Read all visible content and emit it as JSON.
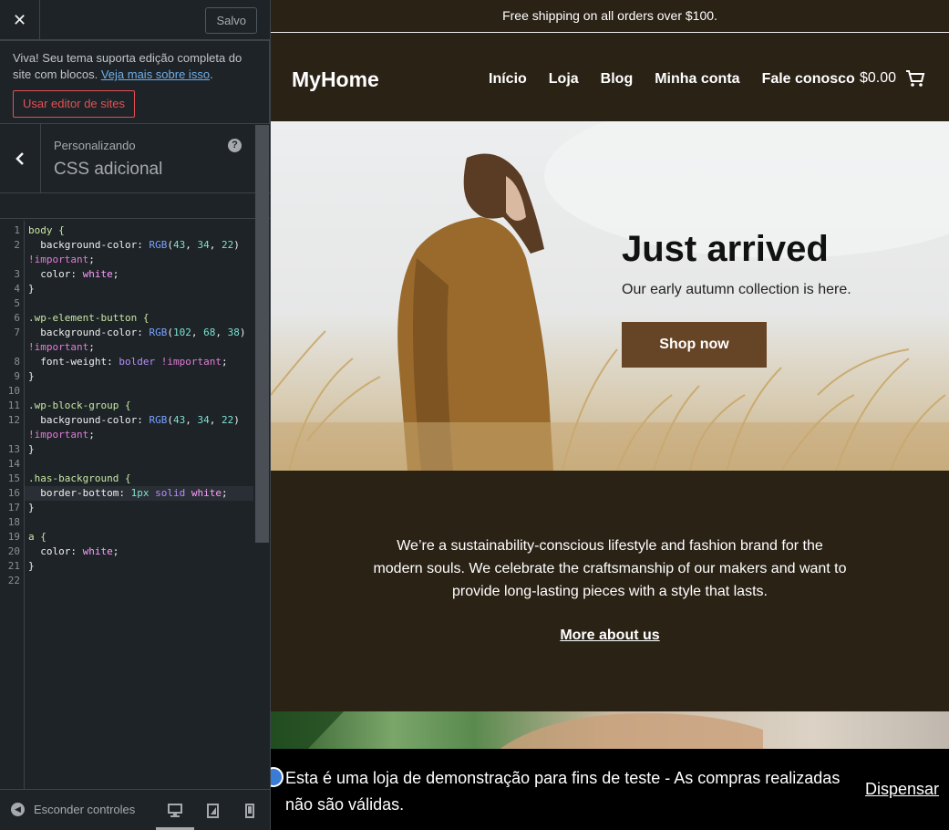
{
  "panel": {
    "saved_label": "Salvo",
    "notice": {
      "text": "Viva! Seu tema suporta edição completa do site com blocos. ",
      "link": "Veja mais sobre isso",
      "after_link": ".",
      "button": "Usar editor de sites"
    },
    "customizing_label": "Personalizando",
    "section_title": "CSS adicional",
    "footer": {
      "hide_controls": "Esconder controles"
    },
    "line_numbers": [
      "1",
      "2",
      "",
      "3",
      "4",
      "5",
      "6",
      "7",
      "",
      "8",
      "9",
      "10",
      "11",
      "12",
      "",
      "13",
      "14",
      "15",
      "16",
      "17",
      "18",
      "19",
      "20",
      "21",
      "22"
    ],
    "code_lines": [
      [
        {
          "t": "body {",
          "c": "t-sel"
        }
      ],
      [
        {
          "t": "  background-color: ",
          "c": "t-prop"
        },
        {
          "t": "RGB",
          "c": "t-fn"
        },
        {
          "t": "(",
          "c": "t-prop"
        },
        {
          "t": "43",
          "c": "t-num"
        },
        {
          "t": ", ",
          "c": "t-prop"
        },
        {
          "t": "34",
          "c": "t-num"
        },
        {
          "t": ", ",
          "c": "t-prop"
        },
        {
          "t": "22",
          "c": "t-num"
        },
        {
          "t": ")",
          "c": "t-prop"
        }
      ],
      [
        {
          "t": "!important",
          "c": "t-imp"
        },
        {
          "t": ";",
          "c": "t-prop"
        }
      ],
      [
        {
          "t": "  color: ",
          "c": "t-prop"
        },
        {
          "t": "white",
          "c": "t-str"
        },
        {
          "t": ";",
          "c": "t-prop"
        }
      ],
      [
        {
          "t": "}",
          "c": "t-prop"
        }
      ],
      [
        {
          "t": "",
          "c": "t-prop"
        }
      ],
      [
        {
          "t": ".wp-element-button {",
          "c": "t-sel"
        }
      ],
      [
        {
          "t": "  background-color: ",
          "c": "t-prop"
        },
        {
          "t": "RGB",
          "c": "t-fn"
        },
        {
          "t": "(",
          "c": "t-prop"
        },
        {
          "t": "102",
          "c": "t-num"
        },
        {
          "t": ", ",
          "c": "t-prop"
        },
        {
          "t": "68",
          "c": "t-num"
        },
        {
          "t": ", ",
          "c": "t-prop"
        },
        {
          "t": "38",
          "c": "t-num"
        },
        {
          "t": ")",
          "c": "t-prop"
        }
      ],
      [
        {
          "t": "!important",
          "c": "t-imp"
        },
        {
          "t": ";",
          "c": "t-prop"
        }
      ],
      [
        {
          "t": "  font-weight: ",
          "c": "t-prop"
        },
        {
          "t": "bolder",
          "c": "t-kw"
        },
        {
          "t": " ",
          "c": "t-prop"
        },
        {
          "t": "!important",
          "c": "t-imp"
        },
        {
          "t": ";",
          "c": "t-prop"
        }
      ],
      [
        {
          "t": "}",
          "c": "t-prop"
        }
      ],
      [
        {
          "t": "",
          "c": "t-prop"
        }
      ],
      [
        {
          "t": ".wp-block-group {",
          "c": "t-sel"
        }
      ],
      [
        {
          "t": "  background-color: ",
          "c": "t-prop"
        },
        {
          "t": "RGB",
          "c": "t-fn"
        },
        {
          "t": "(",
          "c": "t-prop"
        },
        {
          "t": "43",
          "c": "t-num"
        },
        {
          "t": ", ",
          "c": "t-prop"
        },
        {
          "t": "34",
          "c": "t-num"
        },
        {
          "t": ", ",
          "c": "t-prop"
        },
        {
          "t": "22",
          "c": "t-num"
        },
        {
          "t": ")",
          "c": "t-prop"
        }
      ],
      [
        {
          "t": "!important",
          "c": "t-imp"
        },
        {
          "t": ";",
          "c": "t-prop"
        }
      ],
      [
        {
          "t": "}",
          "c": "t-prop"
        }
      ],
      [
        {
          "t": "",
          "c": "t-prop"
        }
      ],
      [
        {
          "t": ".has-background {",
          "c": "t-sel"
        }
      ],
      [
        {
          "t": "  border-bottom: ",
          "c": "t-prop"
        },
        {
          "t": "1px",
          "c": "t-num"
        },
        {
          "t": " ",
          "c": "t-prop"
        },
        {
          "t": "solid",
          "c": "t-kw"
        },
        {
          "t": " ",
          "c": "t-prop"
        },
        {
          "t": "white",
          "c": "t-str"
        },
        {
          "t": ";",
          "c": "t-prop"
        }
      ],
      [
        {
          "t": "}",
          "c": "t-prop"
        }
      ],
      [
        {
          "t": "",
          "c": "t-prop"
        }
      ],
      [
        {
          "t": "a {",
          "c": "t-sel"
        }
      ],
      [
        {
          "t": "  color: ",
          "c": "t-prop"
        },
        {
          "t": "white",
          "c": "t-str"
        },
        {
          "t": ";",
          "c": "t-prop"
        }
      ],
      [
        {
          "t": "}",
          "c": "t-prop"
        }
      ],
      [
        {
          "t": "",
          "c": "t-prop"
        }
      ]
    ],
    "highlighted_line": 18
  },
  "site": {
    "topbar": "Free shipping on all orders over $100.",
    "title": "MyHome",
    "nav": [
      "Início",
      "Loja",
      "Blog",
      "Minha conta",
      "Fale conosco"
    ],
    "cart_total": "$0.00",
    "hero": {
      "title": "Just arrived",
      "subtitle": "Our early autumn collection is here.",
      "button": "Shop now"
    },
    "about": {
      "text": "We’re a sustainability-conscious lifestyle and fashion brand for the modern souls. We celebrate the craftsmanship of our makers and want to provide long-lasting pieces with a style that lasts.",
      "link": "More about us"
    },
    "store_notice": {
      "text": "Esta é uma loja de demonstração para fins de teste - As compras realizadas não são válidas.",
      "dismiss": "Dispensar"
    }
  },
  "colors": {
    "site_background": "#2b2216",
    "button_background": "#664426",
    "panel_background": "#1d2327",
    "accent_red": "#e65054"
  }
}
